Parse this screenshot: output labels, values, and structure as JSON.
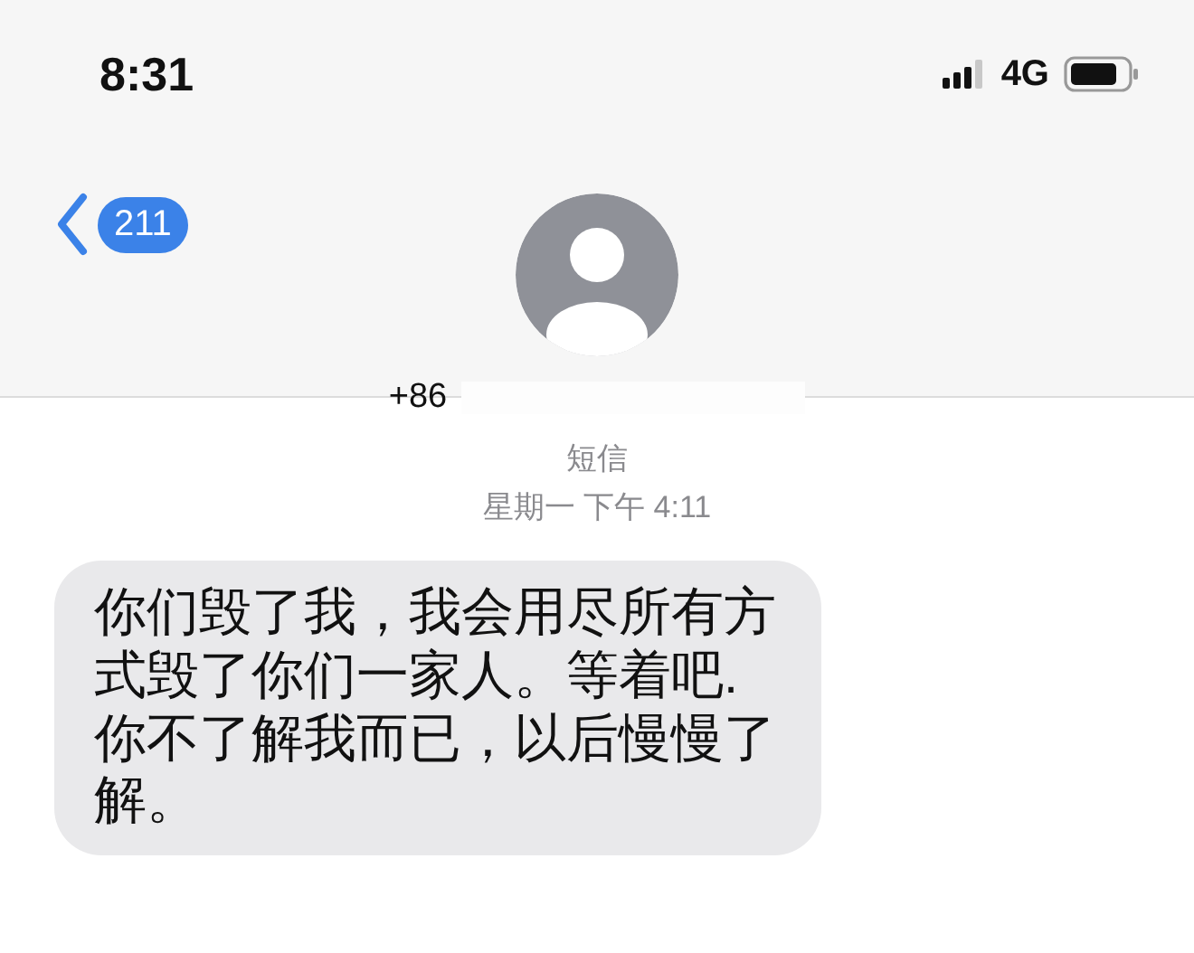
{
  "status_bar": {
    "time": "8:31",
    "network": "4G"
  },
  "header": {
    "back_badge": "211",
    "contact": "+86"
  },
  "thread": {
    "service": "短信",
    "timestamp": "星期一 下午 4:11"
  },
  "messages": [
    {
      "kind": "incoming",
      "text": "你们毁了我，我会用尽所有方式毁了你们一家人。等着吧.你不了解我而已，以后慢慢了解。"
    }
  ]
}
